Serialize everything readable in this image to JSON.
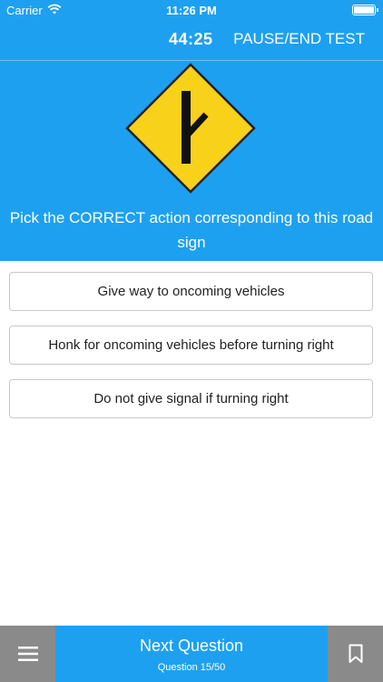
{
  "status_bar": {
    "carrier": "Carrier",
    "time": "11:26 PM"
  },
  "top_bar": {
    "timer": "44:25",
    "pause_label": "PAUSE/END TEST"
  },
  "question": {
    "text": "Pick the CORRECT action corresponding to this road sign"
  },
  "answers": [
    {
      "label": "Give way to oncoming vehicles"
    },
    {
      "label": "Honk for oncoming vehicles before turning right"
    },
    {
      "label": "Do not give signal if turning right"
    }
  ],
  "bottom_bar": {
    "next_label": "Next Question",
    "progress": "Question 15/50"
  },
  "colors": {
    "primary": "#1ea0f0",
    "sign_yellow": "#f7d11a",
    "bar_gray": "#8a8a8a"
  },
  "icons": {
    "menu": "hamburger-icon",
    "bookmark": "bookmark-icon",
    "wifi": "wifi-icon",
    "battery": "battery-icon"
  }
}
